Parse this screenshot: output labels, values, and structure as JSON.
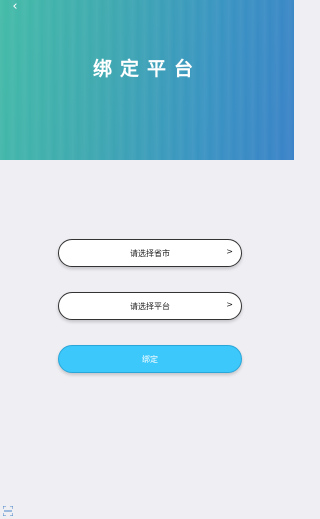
{
  "header": {
    "back_glyph": "‹",
    "title": "绑定平台"
  },
  "form": {
    "province_select": {
      "label": "请选择省市",
      "arrow": ">"
    },
    "platform_select": {
      "label": "请选择平台",
      "arrow": ">"
    },
    "bind_button_label": "绑定"
  },
  "icons": {
    "back": "chevron-left-icon",
    "scan": "scan-icon"
  },
  "colors": {
    "button": "#3cc8fb",
    "header_start": "#44bba8",
    "header_end": "#3a82c8",
    "background": "#efeef3"
  }
}
